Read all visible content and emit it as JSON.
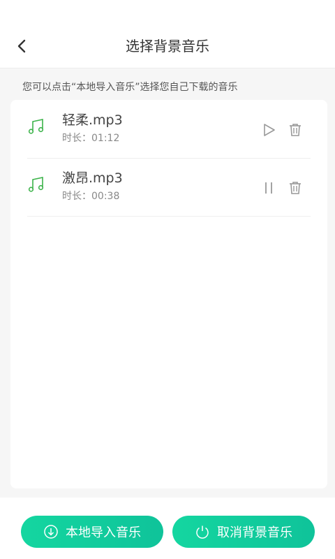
{
  "header": {
    "title": "选择背景音乐"
  },
  "hint": "您可以点击“本地导入音乐”选择您自己下载的音乐",
  "songs": [
    {
      "name": "轻柔.mp3",
      "duration": "时长：01:12",
      "state": "play",
      "icon": "music-note-icon"
    },
    {
      "name": "激昂.mp3",
      "duration": "时长：00:38",
      "state": "pause",
      "icon": "music-note-icon"
    }
  ],
  "bottom": {
    "import_label": "本地导入音乐",
    "cancel_label": "取消背景音乐"
  },
  "colors": {
    "accent": "#14d6a0",
    "note": "#3cb34a",
    "icon": "#999999"
  }
}
